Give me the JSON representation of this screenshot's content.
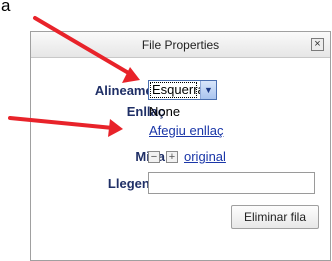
{
  "corner_text": "a",
  "dialog": {
    "title": "File Properties",
    "close_glyph": "×",
    "alignment_label": "Alineament",
    "alignment_value": "Esquerra",
    "link_label": "Enllaç",
    "link_value": "None",
    "add_link": "Afegiu enllaç",
    "size_label": "Mida",
    "size_decrease": "−",
    "size_increase": "+",
    "size_original": "original",
    "caption_label": "Llegenda",
    "caption_value": "",
    "delete_row_button": "Eliminar fila"
  },
  "icons": {
    "dropdown": "chevron-down-icon",
    "close": "close-icon",
    "annotation": "red-arrow-icon"
  },
  "colors": {
    "label": "#1f2f66",
    "link": "#1a36a8",
    "arrow": "#e8232a"
  }
}
